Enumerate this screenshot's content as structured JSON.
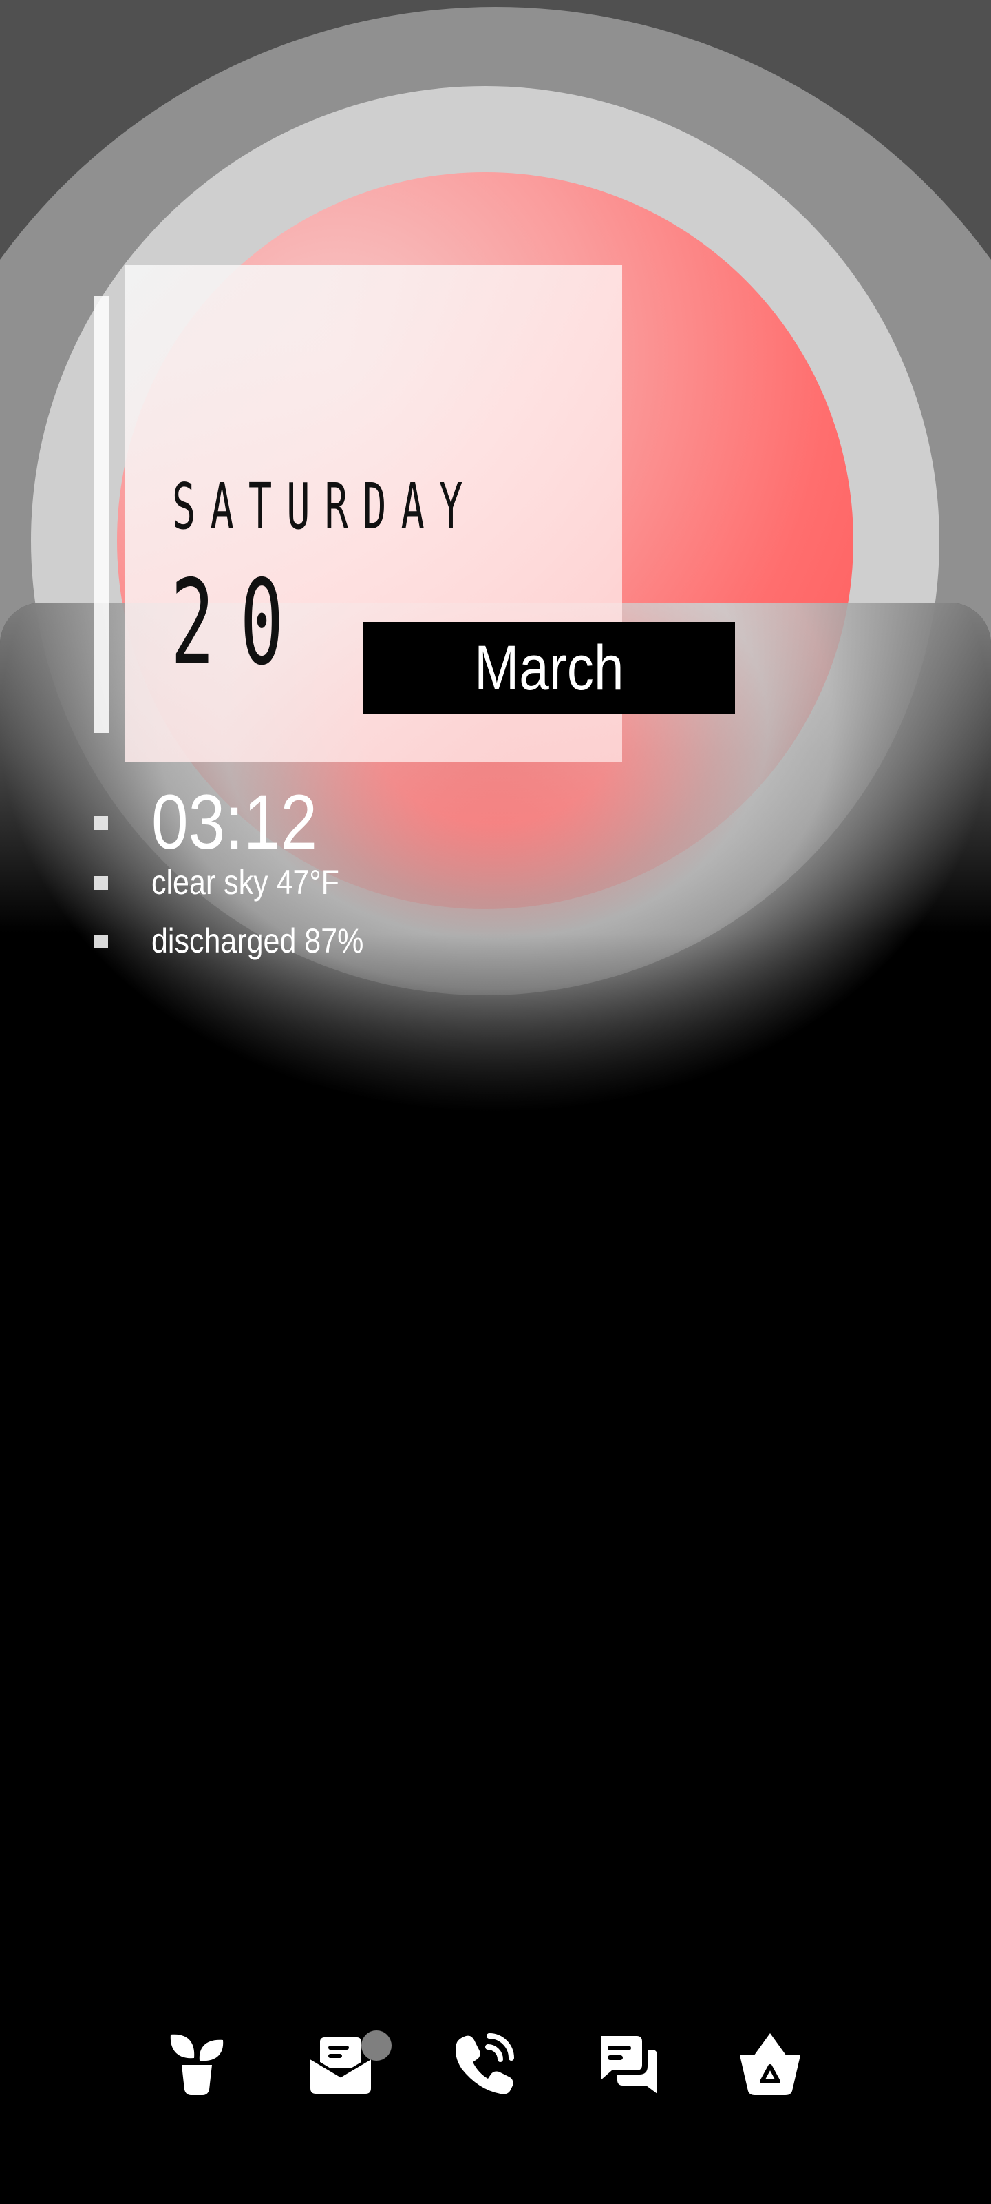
{
  "widget": {
    "day_name": "SATURDAY",
    "day_number": "20",
    "month": "March",
    "time": "03:12",
    "weather": "clear sky 47°F",
    "battery": "discharged 87%"
  },
  "dock": {
    "apps": [
      {
        "icon": "plant-icon"
      },
      {
        "icon": "mail-icon",
        "has_notification": true
      },
      {
        "icon": "phone-call-icon"
      },
      {
        "icon": "chat-icon"
      },
      {
        "icon": "basket-icon"
      }
    ]
  },
  "colors": {
    "accent_red": "#ff5252",
    "background": "#000000",
    "notification_dot": "#7f7f7f"
  }
}
